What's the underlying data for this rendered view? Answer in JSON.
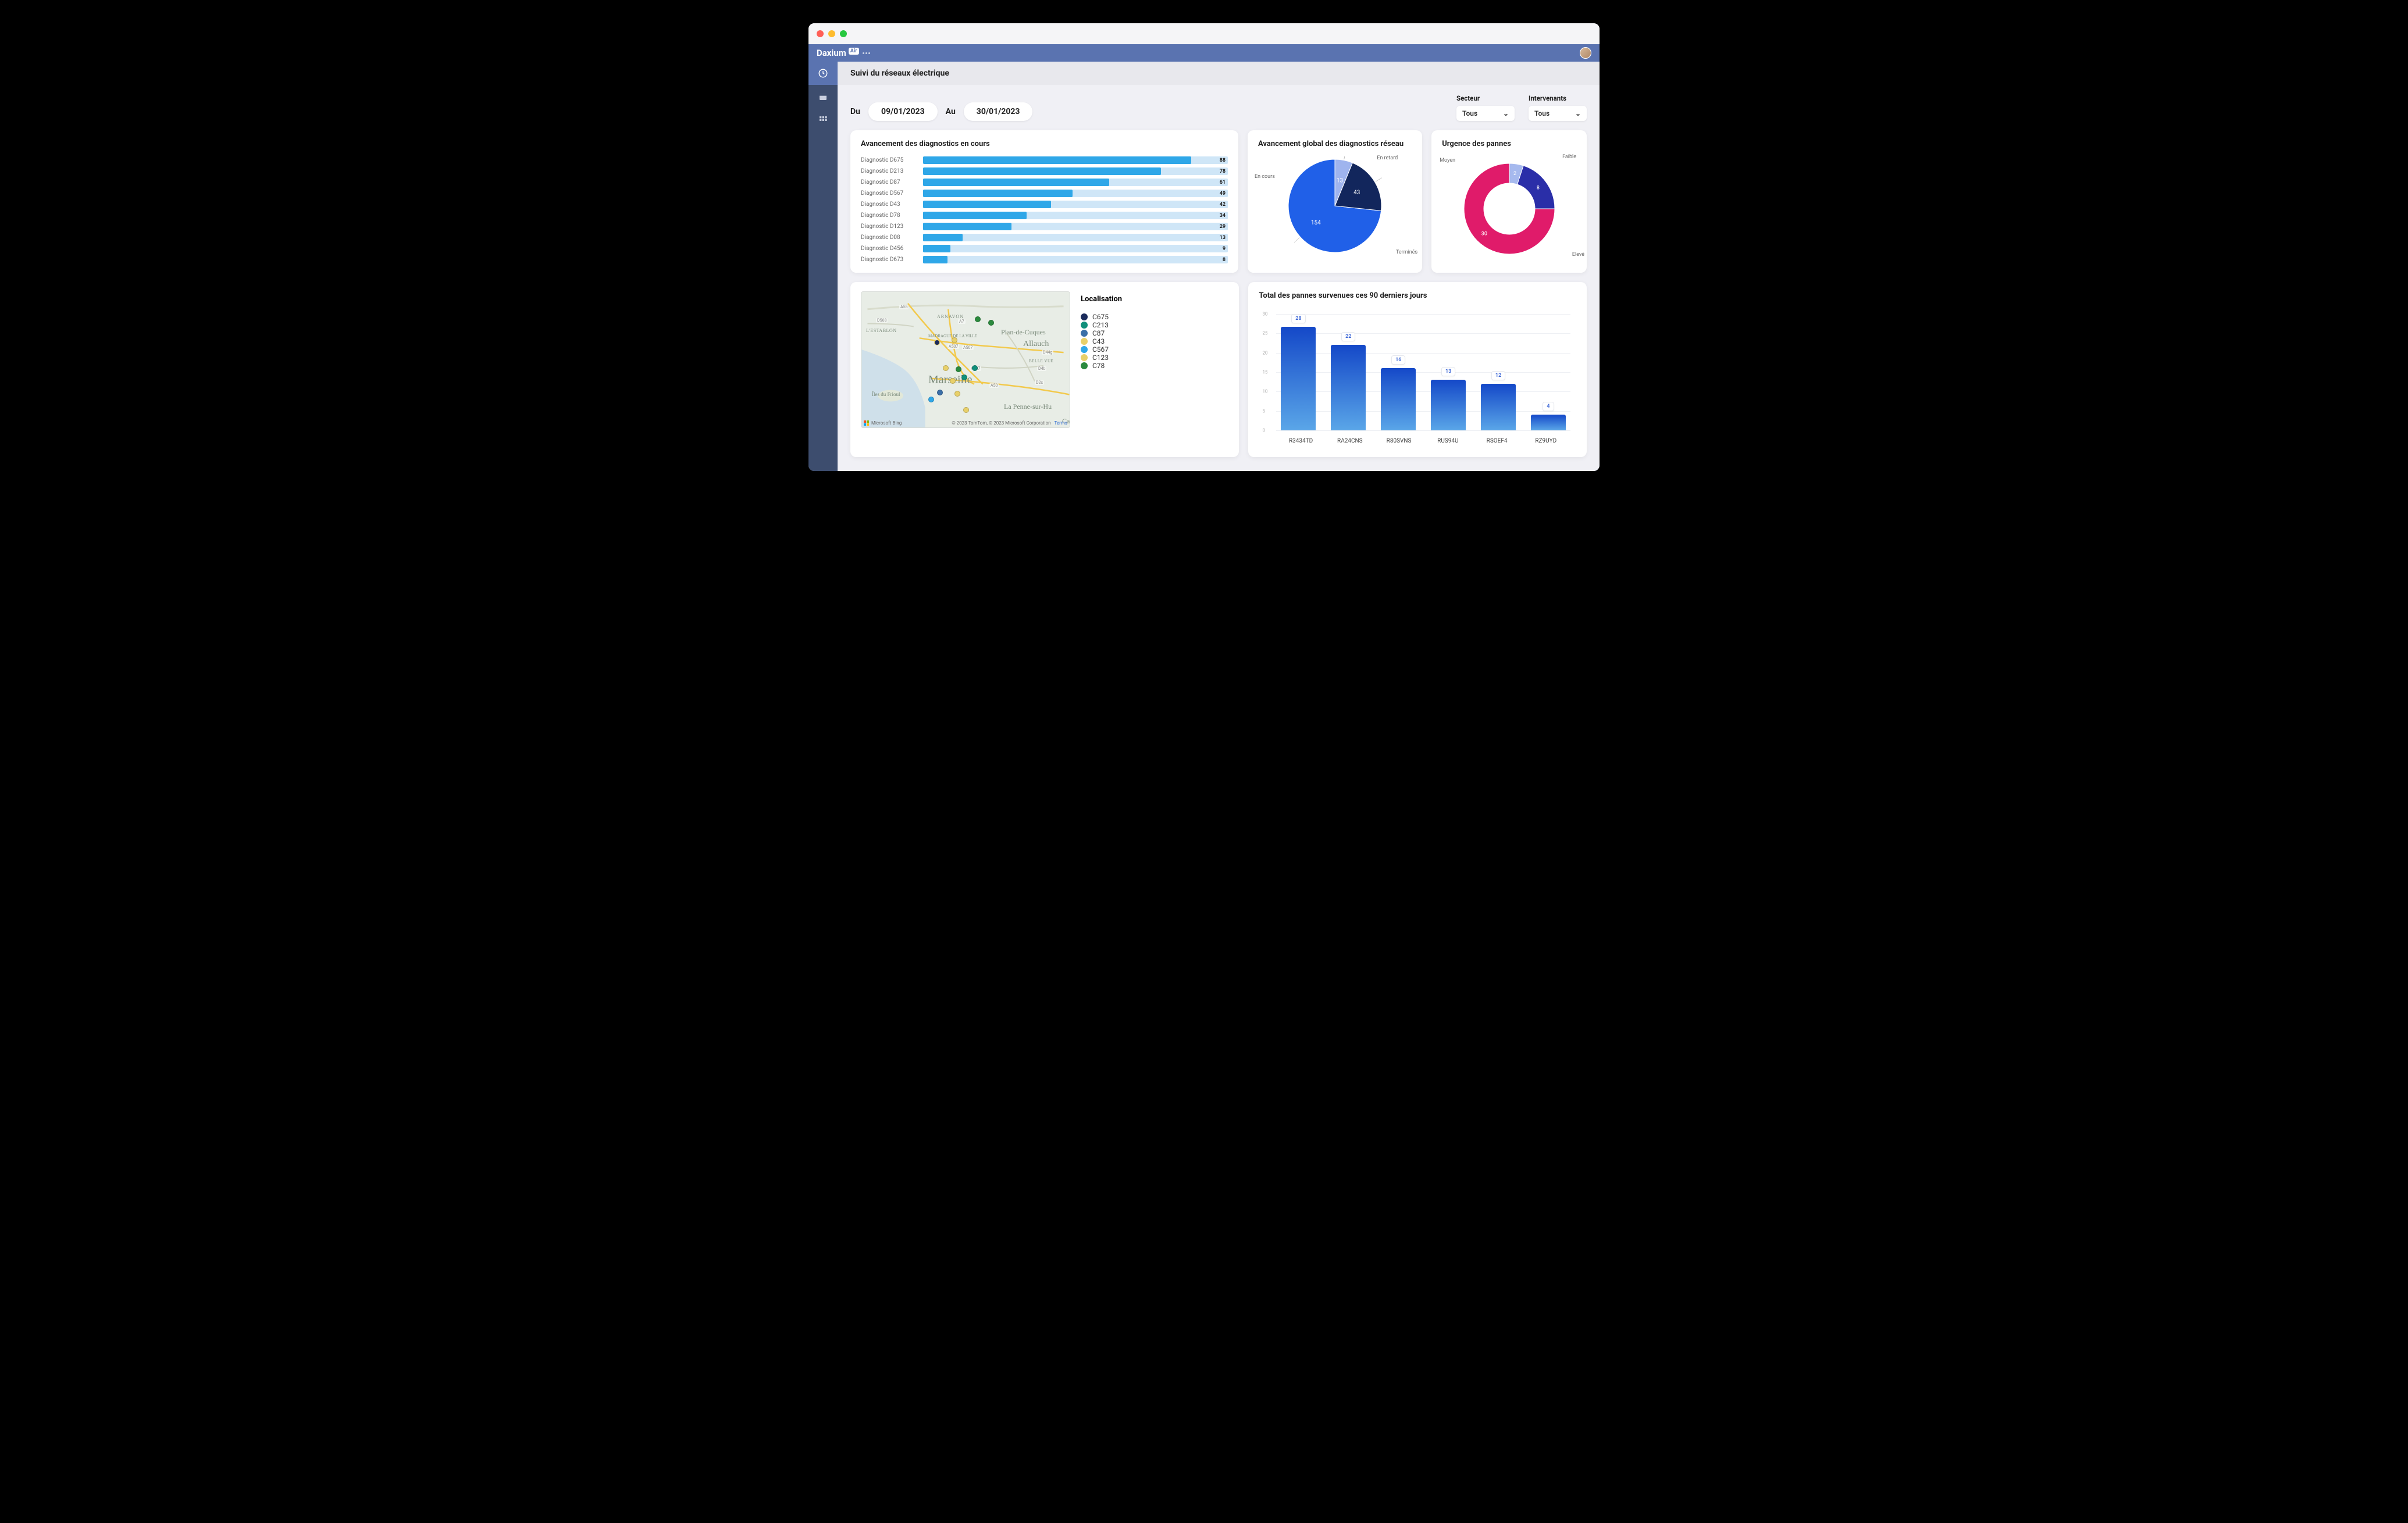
{
  "brand": {
    "name": "Daxium",
    "suffix": "Air"
  },
  "page_title": "Suivi du réseaux électrique",
  "filters": {
    "from_label": "Du",
    "from_value": "09/01/2023",
    "to_label": "Au",
    "to_value": "30/01/2023",
    "sector": {
      "label": "Secteur",
      "value": "Tous"
    },
    "intervenants": {
      "label": "Intervenants",
      "value": "Tous"
    }
  },
  "progress_card": {
    "title": "Avancement des diagnostics en cours",
    "rows": [
      {
        "label": "Diagnostic D675",
        "value": 88
      },
      {
        "label": "Diagnostic  D213",
        "value": 78
      },
      {
        "label": "Diagnostic D87",
        "value": 61
      },
      {
        "label": "Diagnostic D567",
        "value": 49
      },
      {
        "label": "Diagnostic D43",
        "value": 42
      },
      {
        "label": "Diagnostic D78",
        "value": 34
      },
      {
        "label": "Diagnostic D123",
        "value": 29
      },
      {
        "label": "Diagnostic D08",
        "value": 13
      },
      {
        "label": "Diagnostic D456",
        "value": 9
      },
      {
        "label": "Diagnostic D673",
        "value": 8
      }
    ]
  },
  "pie_card": {
    "title": "Avancement global des diagnostics réseau",
    "slices": [
      {
        "label": "Terminés",
        "value": 154,
        "color": "#2060e8"
      },
      {
        "label": "En cours",
        "value": 43,
        "color": "#12265c"
      },
      {
        "label": "En retard",
        "value": 13,
        "color": "#9fb4ee"
      }
    ]
  },
  "donut_card": {
    "title": "Urgence des pannes",
    "slices": [
      {
        "label": "Elevé",
        "value": 30,
        "color": "#e01b6a"
      },
      {
        "label": "Moyen",
        "value": 8,
        "color": "#2a2ea8"
      },
      {
        "label": "Faible",
        "value": 2,
        "color": "#a6b9ee"
      }
    ]
  },
  "map_card": {
    "legend_title": "Localisation",
    "items": [
      {
        "label": "C675",
        "color": "#1b2b5c"
      },
      {
        "label": "C213",
        "color": "#0f8f7a"
      },
      {
        "label": "C87",
        "color": "#3b6fa8"
      },
      {
        "label": "C43",
        "color": "#e8d06a"
      },
      {
        "label": "C567",
        "color": "#2fa7e8"
      },
      {
        "label": "C123",
        "color": "#e8d06a"
      },
      {
        "label": "C78",
        "color": "#2b8a3e"
      }
    ],
    "city": "Marseille",
    "districts": [
      "ARNAVON",
      "Plan-de-Cuques",
      "Allauch",
      "La Penne-sur-Hu",
      "Ca",
      "L'ESTABLON",
      "MADRAGUE DE LA VILLE",
      "BELLE VUE",
      "Îles du Frioul"
    ],
    "roads": [
      "A55",
      "D568",
      "A7",
      "A507",
      "A50",
      "D2c",
      "D4b",
      "D44g"
    ],
    "attrib_left": "Microsoft Bing",
    "attrib_right": "© 2023 TomTom, © 2023 Microsoft Corporation",
    "attrib_terms": "Terms"
  },
  "barchart_card": {
    "title": "Total des pannes survenues ces 90 derniers jours",
    "ymax": 30,
    "yticks": [
      30,
      25,
      20,
      15,
      10,
      5,
      0
    ],
    "bars": [
      {
        "label": "R3434TD",
        "value": 28
      },
      {
        "label": "RA24CNS",
        "value": 22
      },
      {
        "label": "R80SVNS",
        "value": 16
      },
      {
        "label": "RUS94U",
        "value": 13
      },
      {
        "label": "RSOEF4",
        "value": 12
      },
      {
        "label": "RZ9UYD",
        "value": 4
      }
    ]
  },
  "chart_data": [
    {
      "type": "bar",
      "title": "Avancement des diagnostics en cours",
      "orientation": "horizontal",
      "categories": [
        "Diagnostic D675",
        "Diagnostic D213",
        "Diagnostic D87",
        "Diagnostic D567",
        "Diagnostic D43",
        "Diagnostic D78",
        "Diagnostic D123",
        "Diagnostic D08",
        "Diagnostic D456",
        "Diagnostic D673"
      ],
      "values": [
        88,
        78,
        61,
        49,
        42,
        34,
        29,
        13,
        9,
        8
      ],
      "xlim": [
        0,
        100
      ]
    },
    {
      "type": "pie",
      "title": "Avancement global des diagnostics réseau",
      "series": [
        {
          "name": "Terminés",
          "value": 154
        },
        {
          "name": "En cours",
          "value": 43
        },
        {
          "name": "En retard",
          "value": 13
        }
      ]
    },
    {
      "type": "pie",
      "title": "Urgence des pannes",
      "donut": true,
      "series": [
        {
          "name": "Elevé",
          "value": 30
        },
        {
          "name": "Moyen",
          "value": 8
        },
        {
          "name": "Faible",
          "value": 2
        }
      ]
    },
    {
      "type": "bar",
      "title": "Total des pannes survenues ces 90 derniers jours",
      "categories": [
        "R3434TD",
        "RA24CNS",
        "R80SVNS",
        "RUS94U",
        "RSOEF4",
        "RZ9UYD"
      ],
      "values": [
        28,
        22,
        16,
        13,
        12,
        4
      ],
      "ylim": [
        0,
        30
      ]
    }
  ]
}
